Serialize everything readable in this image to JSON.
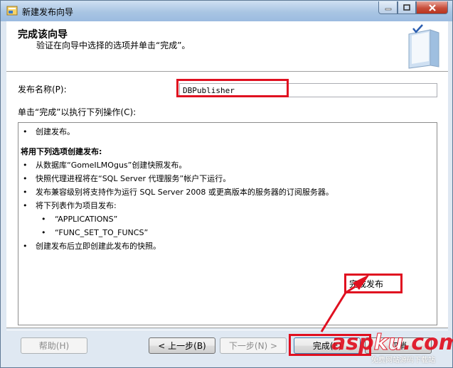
{
  "window": {
    "title": "新建发布向导"
  },
  "header": {
    "title": "完成该向导",
    "subtitle": "验证在向导中选择的选项并单击“完成”。"
  },
  "form": {
    "name_label": "发布名称(P):",
    "name_value": "DBPublisher",
    "ops_label": "单击“完成”以执行下列操作(C):"
  },
  "ops": {
    "create": "创建发布。",
    "heading": "将用下列选项创建发布:",
    "items": [
      "从数据库“GomeILMOgus”创建快照发布。",
      "快照代理进程将在“SQL Server 代理服务”帐户下运行。",
      "发布兼容级别将支持作为运行 SQL Server 2008 或更高版本的服务器的订阅服务器。",
      "将下列表作为项目发布:"
    ],
    "articles": [
      "“APPLICATIONS”",
      "“FUNC_SET_TO_FUNCS”"
    ],
    "snapshot": "创建发布后立即创建此发布的快照。"
  },
  "buttons": {
    "help": "帮助(H)",
    "back": "< 上一步(B)",
    "next": "下一步(N) >",
    "finish": "完成(F)",
    "cancel": "取消"
  },
  "annotation": {
    "callout": "完成发布"
  },
  "watermark": {
    "brand_a": "asp",
    "brand_b": "ku",
    "brand_c": ".com",
    "tagline": "免费网站源码下载站"
  },
  "colors": {
    "annotation_red": "#e01020",
    "titlebar": "#a9c5e3"
  }
}
